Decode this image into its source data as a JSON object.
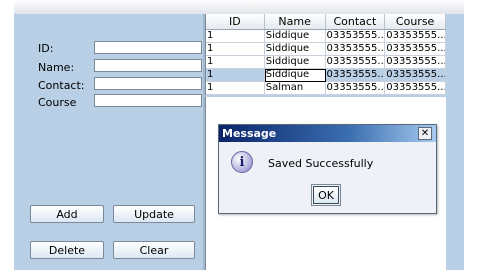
{
  "form": {
    "labels": {
      "id": "ID:",
      "name": "Name:",
      "contact": "Contact:",
      "course": "Course"
    },
    "values": {
      "id": "",
      "name": "",
      "contact": "",
      "course": ""
    }
  },
  "buttons": {
    "add": "Add",
    "update": "Update",
    "delete": "Delete",
    "clear": "Clear"
  },
  "table": {
    "columns": [
      "ID",
      "Name",
      "Contact",
      "Course"
    ],
    "rows": [
      [
        "1",
        "Siddique",
        "03353555...",
        "03353555..."
      ],
      [
        "1",
        "Siddique",
        "03353555...",
        "03353555..."
      ],
      [
        "1",
        "Siddique",
        "03353555...",
        "03353555..."
      ],
      [
        "1",
        "Siddique",
        "03353555...",
        "03353555..."
      ],
      [
        "1",
        "Salman",
        "03353555...",
        "03353555..."
      ]
    ],
    "selected_row": 3
  },
  "dialog": {
    "title": "Message",
    "close_glyph": "✕",
    "icon": "information-icon",
    "icon_glyph": "i",
    "message": "Saved Successfully",
    "ok_label": "OK"
  },
  "colors": {
    "panel": "#b8cfe5",
    "title_bar": "#0a246a",
    "selection": "#b8cfe5"
  }
}
